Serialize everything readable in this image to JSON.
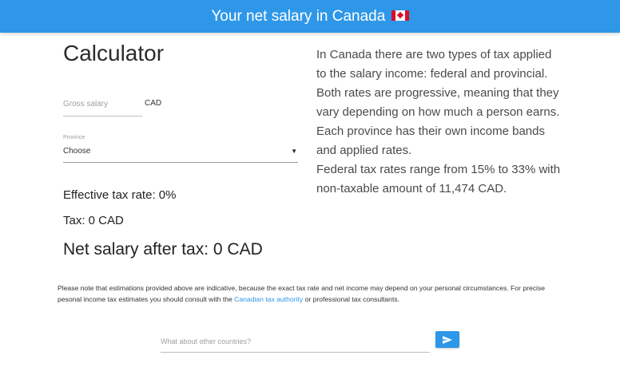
{
  "header": {
    "title": "Your net salary in Canada",
    "flag_icon": "canada-flag-icon",
    "background": "#2f97e8"
  },
  "calculator": {
    "title": "Calculator",
    "gross_salary_placeholder": "Gross salary",
    "currency": "CAD",
    "province_label": "Province",
    "province_value": "Choose",
    "province_arrow": "▼",
    "effective_tax_rate": "Effective tax rate: 0%",
    "tax": "Tax: 0 CAD",
    "net_salary": "Net salary after tax: 0 CAD"
  },
  "info": {
    "text": "In Canada there are two types of tax applied to the salary income: federal and provincial. Both rates are progressive, meaning that they vary depending on how much a person earns. Each province has their own income bands and applied rates.",
    "federal": "Federal tax rates range from 15% to 33% with non-taxable amount of 11,474 CAD."
  },
  "note": {
    "before_link": "Please note that estimations provided above are indicative, because the exact tax rate and net income may depend on your personal circumstances. For precise pesonal income tax estimates you should consult with the ",
    "link_text": "Canadian tax authority",
    "after_link": " or professional tax consultants."
  },
  "countries": {
    "placeholder": "What about other countries?",
    "button_icon": "send-arrow-icon"
  },
  "colors": {
    "accent": "#2f97e8"
  }
}
